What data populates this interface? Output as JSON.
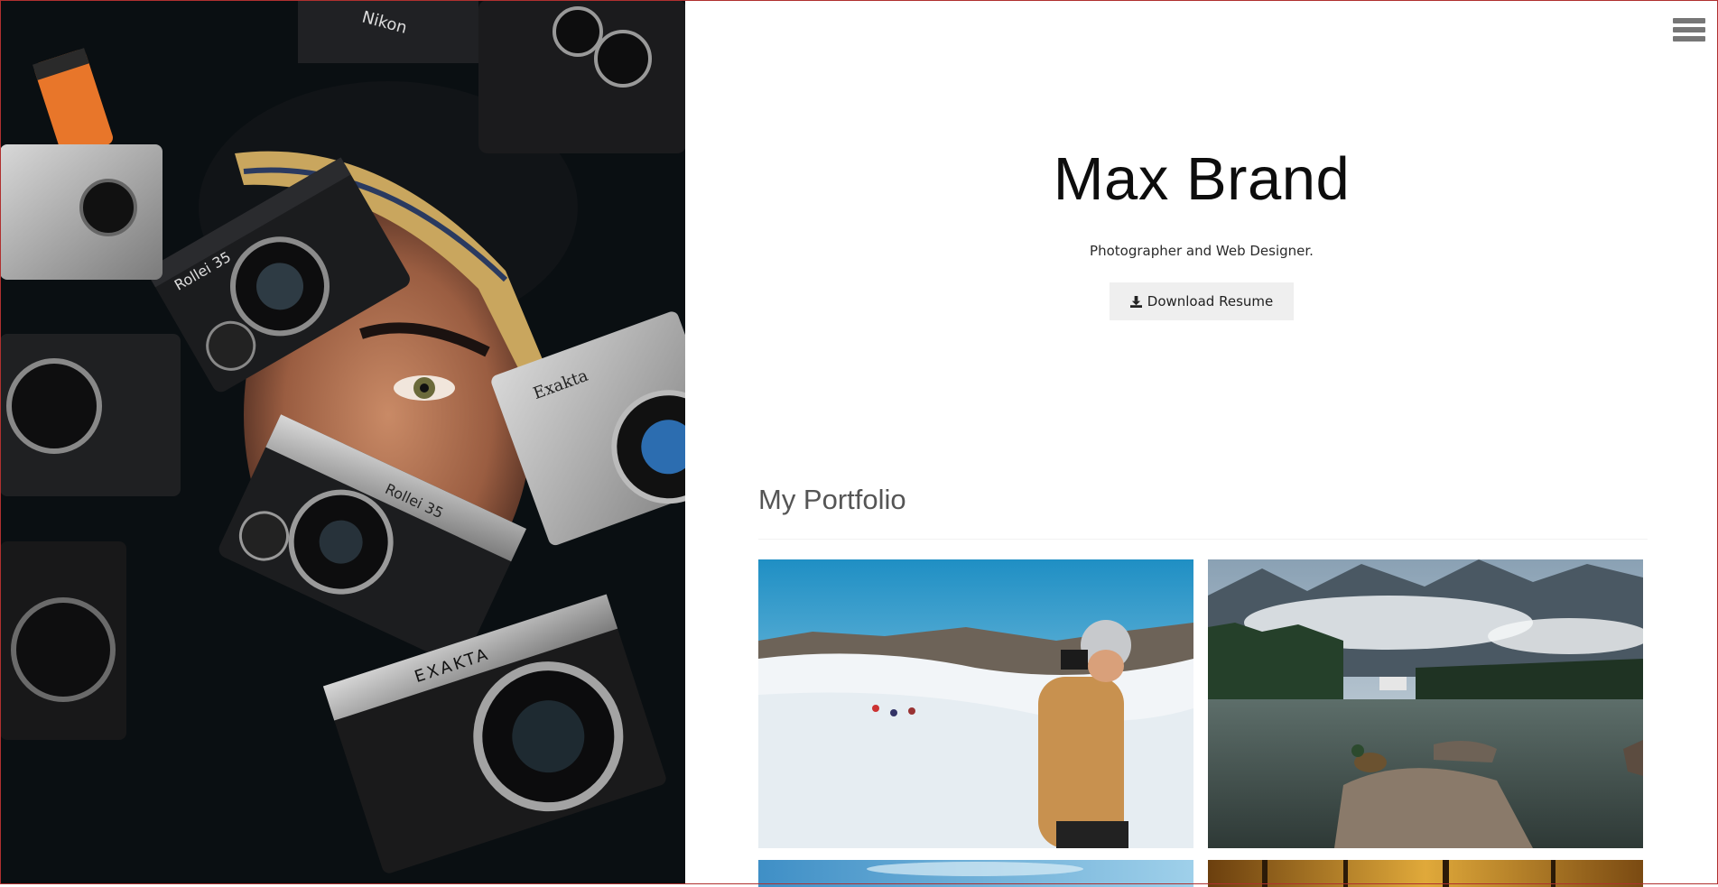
{
  "hero": {
    "image": "photographer-face-surrounded-by-vintage-cameras",
    "camera_labels": [
      "Rollei 35",
      "Rollei 35",
      "EXAKTA",
      "Exakta",
      "Nikon"
    ]
  },
  "nav": {
    "menu_icon": "hamburger-icon"
  },
  "intro": {
    "name": "Max Brand",
    "tagline": "Photographer and Web Designer.",
    "resume_button": "Download Resume",
    "resume_icon": "download-icon"
  },
  "portfolio": {
    "title": "My Portfolio",
    "items": [
      {
        "image": "hiker-photographing-snowy-mountains"
      },
      {
        "image": "mountain-lake-with-duck-on-rocks"
      },
      {
        "image": "sky-landscape-partial"
      },
      {
        "image": "golden-forest-partial"
      }
    ]
  },
  "colors": {
    "frame": "#b0302f",
    "button_bg": "#efefef",
    "menu_icon": "#777777"
  }
}
